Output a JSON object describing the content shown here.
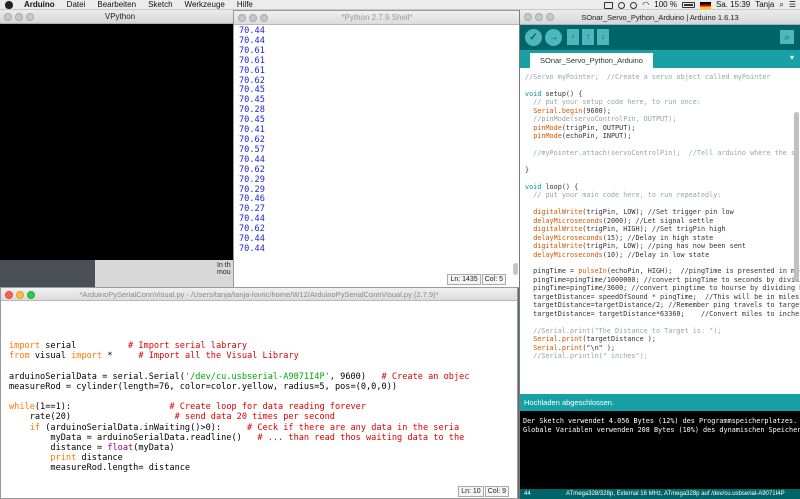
{
  "menubar": {
    "app": "Arduino",
    "items": [
      "Datei",
      "Bearbeiten",
      "Sketch",
      "Werkzeuge",
      "Hilfe"
    ],
    "battery": "100 %",
    "clock": "Sa. 15:39",
    "user": "Tanja"
  },
  "vpython": {
    "title": "VPython"
  },
  "behind": {
    "text": "In th\nmou"
  },
  "shell": {
    "title": "*Python 2.7.9 Shell*",
    "output": "70.44\n70.44\n70.61\n70.61\n70.61\n70.62\n70.45\n70.45\n70.28\n70.45\n70.41\n70.62\n70.57\n70.44\n70.62\n70.29\n70.29\n70.46\n70.27\n70.44\n70.62\n70.44\n70.44",
    "ln": "Ln: 1435",
    "col": "Col: 5"
  },
  "editor": {
    "title": "*ArduinoPySerialConnVisual.py - /Users/tanja/tanja-lovric/home/W12/ArduinoPySerialConnVisual.py (2.7.9)*",
    "line1_a": "import",
    "line1_b": " serial          ",
    "line1_c": "# Import serial labrary",
    "line2_a": "from",
    "line2_b": " visual ",
    "line2_c": "import",
    "line2_d": " *     ",
    "line2_e": "# Import all the Visual Library",
    "line4_a": "arduinoSerialData = serial.Serial(",
    "line4_b": "'/dev/cu.usbserial-A9071I4P'",
    "line4_c": ", 9600)   ",
    "line4_d": "# Create an objec",
    "line5": "measureRod = cylinder(length=76, color=color.yellow, radius=5, pos=(0,0,0))",
    "line7_a": "while",
    "line7_b": "(1==1):                   ",
    "line7_c": "# Create loop for data reading forever",
    "line8_a": "    rate(20)                    ",
    "line8_b": "# send data 20 times per second",
    "line9_a": "    ",
    "line9_b": "if",
    "line9_c": " (arduinoSerialData.inWaiting()>0):     ",
    "line9_d": "# Ceck if there are any data in the seria",
    "line10_a": "        myData = arduinoSerialData.readline()   ",
    "line10_b": "# ... than read thos waiting data to the",
    "line11_a": "        distance = ",
    "line11_b": "float",
    "line11_c": "(myData)",
    "line12_a": "        ",
    "line12_b": "print",
    "line12_c": " distance",
    "line13": "        measureRod.length= distance",
    "ln": "Ln: 10",
    "col": "Col: 9"
  },
  "arduino": {
    "title": "SOnar_Servo_Python_Arduino | Arduino 1.6.13",
    "tab": "SOnar_Servo_Python_Arduino",
    "message": "Hochladen abgeschlossen.",
    "console": "Der Sketch verwendet 4.056 Bytes (12%) des Programmspeicherplatzes. Das\nGlobale Variablen verwenden 208 Bytes (10%) des dynamischen Speichers,",
    "line_no": "44",
    "board": "ATmega328/328p, External 16 MHz, ATmega328p auf /dev/cu.usbserial-A9071I4P",
    "code": {
      "l1": "//Servo myPointer;  //Create a servo object called myPointer",
      "l3a": "void",
      "l3b": " setup() {",
      "l4": "  // put your setup code here, to run once:",
      "l5a": "  ",
      "l5b": "Serial",
      "l5c": ".",
      "l5d": "begin",
      "l5e": "(9600);",
      "l6": "  //pinMode(servoControlPin, OUTPUT);",
      "l7a": "  ",
      "l7b": "pinMode",
      "l7c": "(trigPin, OUTPUT);",
      "l8a": "  ",
      "l8b": "pinMode",
      "l8c": "(echoPin, INPUT);",
      "l10": "  //myPointer.attach(servoControlPin);  //Tell arduino where the ser",
      "l12": "}",
      "l14a": "void",
      "l14b": " loop() {",
      "l15": "  // put your main code here, to run repeatedly:",
      "l17a": "  ",
      "l17b": "digitalWrite",
      "l17c": "(trigPin, LOW); //Set trigger pin low",
      "l18a": "  ",
      "l18b": "delayMicroseconds",
      "l18c": "(2000); //Let signal settle",
      "l19a": "  ",
      "l19b": "digitalWrite",
      "l19c": "(trigPin, HIGH); //Set trigPin high",
      "l20a": "  ",
      "l20b": "delayMicroseconds",
      "l20c": "(15); //Delay in high state",
      "l21a": "  ",
      "l21b": "digitalWrite",
      "l21c": "(trigPin, LOW); //ping has now been sent",
      "l22a": "  ",
      "l22b": "delayMicroseconds",
      "l22c": "(10); //Delay in low state",
      "l24a": "  pingTime = ",
      "l24b": "pulseIn",
      "l24c": "(echoPin, HIGH);  //pingTime is presented in mic",
      "l25": "  pingTime=pingTime/1000000; //convert pingTime to seconds by dividi",
      "l26": "  pingTime=pingTime/3600; //convert pingtime to hourse by dividing b",
      "l27": "  targetDistance= speedOfSound * pingTime;  //This will be in miles,",
      "l28": "  targetDistance=targetDistance/2; //Remember ping travels to target",
      "l29": "  targetDistance= targetDistance*63360;    //Convert miles to inches",
      "l31": "  //Serial.print(\"The Distance to Target is: \");",
      "l32a": "  ",
      "l32b": "Serial",
      "l32c": ".",
      "l32d": "print",
      "l32e": "(targetDistance );",
      "l33a": "  ",
      "l33b": "Serial",
      "l33c": ".",
      "l33d": "print",
      "l33e": "(\"\\n\" );",
      "l34": "  //Serial.println(\" inches\");"
    }
  }
}
